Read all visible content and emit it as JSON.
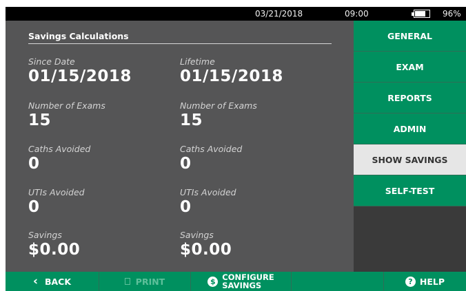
{
  "status": {
    "date": "03/21/2018",
    "time": "09:00",
    "battery": "96%"
  },
  "main": {
    "title": "Savings Calculations",
    "since": {
      "date_label": "Since Date",
      "date": "01/15/2018",
      "exams_label": "Number of Exams",
      "exams": "15",
      "caths_label": "Caths Avoided",
      "caths": "0",
      "utis_label": "UTIs Avoided",
      "utis": "0",
      "savings_label": "Savings",
      "savings": "$0.00"
    },
    "lifetime": {
      "date_label": "Lifetime",
      "date": "01/15/2018",
      "exams_label": "Number of Exams",
      "exams": "15",
      "caths_label": "Caths Avoided",
      "caths": "0",
      "utis_label": "UTIs Avoided",
      "utis": "0",
      "savings_label": "Savings",
      "savings": "$0.00"
    }
  },
  "menu": {
    "general": "GENERAL",
    "exam": "EXAM",
    "reports": "REPORTS",
    "admin": "ADMIN",
    "show_savings": "SHOW SAVINGS",
    "self_test": "SELF-TEST"
  },
  "bottom": {
    "back": "BACK",
    "back_icon": "chevron-left-icon",
    "print": "PRINT",
    "print_icon": "printer-icon",
    "configure_line1": "CONFIGURE",
    "configure_line2": "SAVINGS",
    "configure_icon": "dollar-icon",
    "help": "HELP",
    "help_icon": "help-icon"
  },
  "colors": {
    "accent": "#00905f",
    "panel": "#555556",
    "selected": "#e6e6e6"
  }
}
